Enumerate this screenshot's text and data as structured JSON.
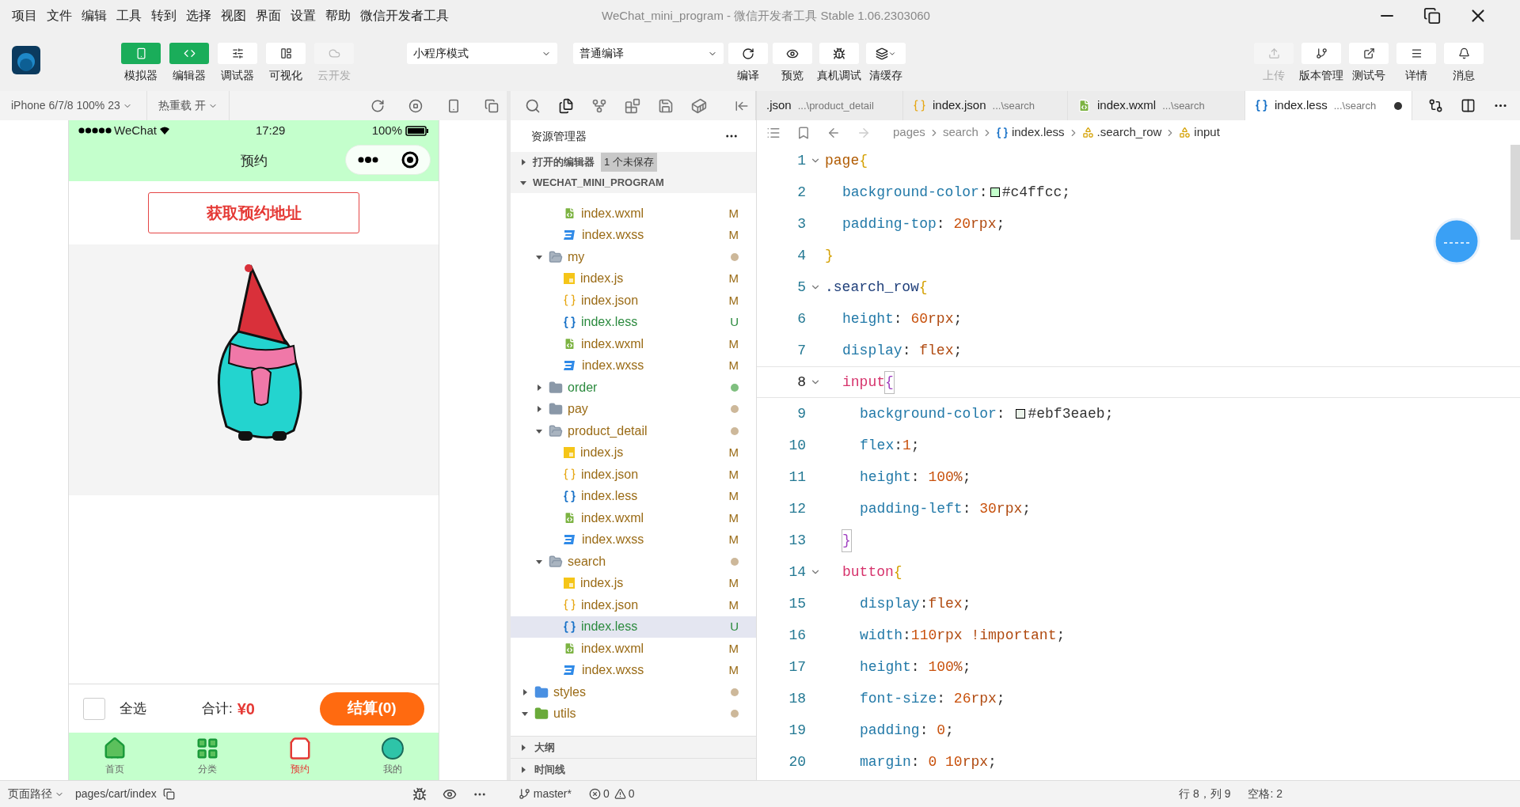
{
  "menu": [
    "项目",
    "文件",
    "编辑",
    "工具",
    "转到",
    "选择",
    "视图",
    "界面",
    "设置",
    "帮助",
    "微信开发者工具"
  ],
  "window": {
    "title": "WeChat_mini_program - 微信开发者工具 Stable 1.06.2303060"
  },
  "view_toggles": [
    {
      "label": "模拟器",
      "selected": true,
      "disabled": false
    },
    {
      "label": "编辑器",
      "selected": true,
      "disabled": false
    },
    {
      "label": "调试器",
      "selected": false,
      "disabled": false
    },
    {
      "label": "可视化",
      "selected": false,
      "disabled": false
    },
    {
      "label": "云开发",
      "selected": false,
      "disabled": true
    }
  ],
  "mode_select": {
    "value": "小程序模式"
  },
  "compile_select": {
    "value": "普通编译"
  },
  "actions": [
    {
      "label": "编译",
      "menu": false
    },
    {
      "label": "预览",
      "menu": false
    },
    {
      "label": "真机调试",
      "menu": false
    },
    {
      "label": "清缓存",
      "menu": true
    }
  ],
  "right_actions": [
    {
      "label": "上传",
      "disabled": true
    },
    {
      "label": "版本管理",
      "disabled": false
    },
    {
      "label": "测试号",
      "disabled": false
    },
    {
      "label": "详情",
      "disabled": false
    },
    {
      "label": "消息",
      "disabled": false
    }
  ],
  "simulator": {
    "device": "iPhone 6/7/8 100% 23",
    "hot_reload": "热重载 开",
    "phone": {
      "carrier": "WeChat",
      "time": "17:29",
      "battery": "100%",
      "title": "预约",
      "action_button": "获取预约地址",
      "select_all": {
        "label": "全选",
        "checked": false
      },
      "total_label": "合计:",
      "total": "¥0",
      "checkout": "结算(0)",
      "tabbar": [
        {
          "label": "首页",
          "selected": false
        },
        {
          "label": "分类",
          "selected": false
        },
        {
          "label": "预约",
          "selected": true
        },
        {
          "label": "我的",
          "selected": false
        }
      ]
    }
  },
  "explorer": {
    "title": "资源管理器",
    "open_editors": {
      "label": "打开的编辑器",
      "badge": "1 个未保存",
      "expanded": false
    },
    "project": {
      "label": "WECHAT_MINI_PROGRAM",
      "expanded": true
    },
    "tree": [
      {
        "kind": "continuation",
        "children": [
          {
            "kind": "continuation",
            "children": [
              {
                "kind": "wxml",
                "name": "index.wxml",
                "untracked": false,
                "badge": "M",
                "selected": false
              },
              {
                "kind": "wxss",
                "name": "index.wxss",
                "untracked": false,
                "badge": "M",
                "selected": false
              }
            ]
          },
          {
            "kind": "folder",
            "name": "my",
            "untracked": false,
            "expanded": true,
            "selected": false,
            "children": [
              {
                "kind": "js",
                "name": "index.js",
                "untracked": false,
                "badge": "M",
                "selected": false
              },
              {
                "kind": "json",
                "name": "index.json",
                "untracked": false,
                "badge": "M",
                "selected": false
              },
              {
                "kind": "less",
                "name": "index.less",
                "untracked": true,
                "badge": "U",
                "selected": false
              },
              {
                "kind": "wxml",
                "name": "index.wxml",
                "untracked": false,
                "badge": "M",
                "selected": false
              },
              {
                "kind": "wxss",
                "name": "index.wxss",
                "untracked": false,
                "badge": "M",
                "selected": false
              }
            ]
          },
          {
            "kind": "folder",
            "name": "order",
            "untracked": true,
            "expanded": false,
            "selected": false
          },
          {
            "kind": "folder",
            "name": "pay",
            "untracked": false,
            "expanded": false,
            "selected": false
          },
          {
            "kind": "folder",
            "name": "product_detail",
            "untracked": false,
            "expanded": true,
            "selected": false,
            "children": [
              {
                "kind": "js",
                "name": "index.js",
                "untracked": false,
                "badge": "M",
                "selected": false
              },
              {
                "kind": "json",
                "name": "index.json",
                "untracked": false,
                "badge": "M",
                "selected": false
              },
              {
                "kind": "less",
                "name": "index.less",
                "untracked": false,
                "badge": "M",
                "selected": false
              },
              {
                "kind": "wxml",
                "name": "index.wxml",
                "untracked": false,
                "badge": "M",
                "selected": false
              },
              {
                "kind": "wxss",
                "name": "index.wxss",
                "untracked": false,
                "badge": "M",
                "selected": false
              }
            ]
          },
          {
            "kind": "folder",
            "name": "search",
            "untracked": false,
            "expanded": true,
            "selected": false,
            "children": [
              {
                "kind": "js",
                "name": "index.js",
                "untracked": false,
                "badge": "M",
                "selected": false
              },
              {
                "kind": "json",
                "name": "index.json",
                "untracked": false,
                "badge": "M",
                "selected": false
              },
              {
                "kind": "less",
                "name": "index.less",
                "untracked": true,
                "badge": "U",
                "selected": true
              },
              {
                "kind": "wxml",
                "name": "index.wxml",
                "untracked": false,
                "badge": "M",
                "selected": false
              },
              {
                "kind": "wxss",
                "name": "index.wxss",
                "untracked": false,
                "badge": "M",
                "selected": false
              }
            ]
          }
        ]
      },
      {
        "kind": "styles-folder",
        "name": "styles",
        "untracked": false,
        "expanded": false,
        "selected": false
      },
      {
        "kind": "utils-folder",
        "name": "utils",
        "untracked": false,
        "expanded": true,
        "selected": false
      }
    ],
    "outline": {
      "label": "大纲",
      "expanded": false
    },
    "timeline": {
      "label": "时间线",
      "expanded": false
    }
  },
  "tabs": [
    {
      "name": ".json",
      "path": "...\\product_detail",
      "selected": false,
      "unsaved": false
    },
    {
      "name": "index.json",
      "path": "...\\search",
      "kind": "json",
      "selected": false,
      "unsaved": false
    },
    {
      "name": "index.wxml",
      "path": "...\\search",
      "kind": "wxml",
      "selected": false,
      "unsaved": false
    },
    {
      "name": "index.less",
      "path": "...\\search",
      "kind": "less",
      "selected": true,
      "unsaved": true
    }
  ],
  "breadcrumb": [
    {
      "kind": "folder",
      "text": "pages"
    },
    {
      "kind": "folder",
      "text": "search"
    },
    {
      "kind": "file",
      "text": "index.less"
    },
    {
      "kind": "symbol",
      "text": ".search_row"
    },
    {
      "kind": "symbol",
      "text": "input"
    }
  ],
  "code": [
    {
      "number": "1",
      "kind": "outer",
      "foldable": true,
      "current": false,
      "tokens": [
        {
          "kind": "selector",
          "text": "page"
        },
        {
          "kind": "brace",
          "text": "{"
        }
      ]
    },
    {
      "number": "2",
      "kind": "inner",
      "foldable": false,
      "current": false,
      "tokens": [
        {
          "kind": "property",
          "text": "background-color"
        },
        {
          "kind": "punct",
          "text": ":"
        },
        {
          "kind": "swatch",
          "color": "#c4ffcc"
        },
        {
          "kind": "punct",
          "text": "#c4ffcc;"
        }
      ]
    },
    {
      "number": "3",
      "kind": "inner",
      "foldable": false,
      "current": false,
      "tokens": [
        {
          "kind": "property",
          "text": "padding-top"
        },
        {
          "kind": "punct",
          "text": ": "
        },
        {
          "kind": "number",
          "text": "20"
        },
        {
          "kind": "value",
          "text": "rpx"
        },
        {
          "kind": "punct",
          "text": ";"
        }
      ]
    },
    {
      "number": "4",
      "kind": "outer",
      "foldable": false,
      "current": false,
      "tokens": [
        {
          "kind": "brace",
          "text": "}"
        }
      ]
    },
    {
      "number": "5",
      "kind": "outer",
      "foldable": true,
      "current": false,
      "tokens": [
        {
          "kind": "class",
          "text": ".search_row"
        },
        {
          "kind": "brace",
          "text": "{"
        }
      ]
    },
    {
      "number": "6",
      "kind": "inner",
      "foldable": false,
      "current": false,
      "tokens": [
        {
          "kind": "property",
          "text": "height"
        },
        {
          "kind": "punct",
          "text": ": "
        },
        {
          "kind": "number",
          "text": "60"
        },
        {
          "kind": "value",
          "text": "rpx"
        },
        {
          "kind": "punct",
          "text": ";"
        }
      ]
    },
    {
      "number": "7",
      "kind": "inner",
      "foldable": false,
      "current": false,
      "tokens": [
        {
          "kind": "property",
          "text": "display"
        },
        {
          "kind": "punct",
          "text": ": "
        },
        {
          "kind": "value",
          "text": "flex"
        },
        {
          "kind": "punct",
          "text": ";"
        }
      ]
    },
    {
      "number": "8",
      "kind": "inner",
      "foldable": true,
      "current": true,
      "tokens": [
        {
          "kind": "tag",
          "text": "input"
        },
        {
          "kind": "match",
          "text": "{"
        }
      ]
    },
    {
      "number": "9",
      "kind": "innermost",
      "foldable": false,
      "current": false,
      "tokens": [
        {
          "kind": "property",
          "text": "background-color"
        },
        {
          "kind": "punct",
          "text": ": "
        },
        {
          "kind": "swatch",
          "color": "#ebf3ea"
        },
        {
          "kind": "punct",
          "text": "#ebf3eaeb;"
        }
      ]
    },
    {
      "number": "10",
      "kind": "innermost",
      "foldable": false,
      "current": false,
      "tokens": [
        {
          "kind": "property",
          "text": "flex"
        },
        {
          "kind": "punct",
          "text": ":"
        },
        {
          "kind": "number",
          "text": "1"
        },
        {
          "kind": "punct",
          "text": ";"
        }
      ]
    },
    {
      "number": "11",
      "kind": "innermost",
      "foldable": false,
      "current": false,
      "tokens": [
        {
          "kind": "property",
          "text": "height"
        },
        {
          "kind": "punct",
          "text": ": "
        },
        {
          "kind": "number",
          "text": "100"
        },
        {
          "kind": "value",
          "text": "%"
        },
        {
          "kind": "punct",
          "text": ";"
        }
      ]
    },
    {
      "number": "12",
      "kind": "innermost",
      "foldable": false,
      "current": false,
      "tokens": [
        {
          "kind": "property",
          "text": "padding-left"
        },
        {
          "kind": "punct",
          "text": ": "
        },
        {
          "kind": "number",
          "text": "30"
        },
        {
          "kind": "value",
          "text": "rpx"
        },
        {
          "kind": "punct",
          "text": ";"
        }
      ]
    },
    {
      "number": "13",
      "kind": "inner",
      "foldable": false,
      "current": false,
      "tokens": [
        {
          "kind": "match",
          "text": "}"
        }
      ]
    },
    {
      "number": "14",
      "kind": "inner",
      "foldable": true,
      "current": false,
      "tokens": [
        {
          "kind": "tag",
          "text": "button"
        },
        {
          "kind": "brace",
          "text": "{"
        }
      ]
    },
    {
      "number": "15",
      "kind": "innermost",
      "foldable": false,
      "current": false,
      "tokens": [
        {
          "kind": "property",
          "text": "display"
        },
        {
          "kind": "punct",
          "text": ":"
        },
        {
          "kind": "value",
          "text": "flex"
        },
        {
          "kind": "punct",
          "text": ";"
        }
      ]
    },
    {
      "number": "16",
      "kind": "innermost",
      "foldable": false,
      "current": false,
      "tokens": [
        {
          "kind": "property",
          "text": "width"
        },
        {
          "kind": "punct",
          "text": ":"
        },
        {
          "kind": "number",
          "text": "110"
        },
        {
          "kind": "value",
          "text": "rpx !important"
        },
        {
          "kind": "punct",
          "text": ";"
        }
      ]
    },
    {
      "number": "17",
      "kind": "innermost",
      "foldable": false,
      "current": false,
      "tokens": [
        {
          "kind": "property",
          "text": "height"
        },
        {
          "kind": "punct",
          "text": ": "
        },
        {
          "kind": "number",
          "text": "100"
        },
        {
          "kind": "value",
          "text": "%"
        },
        {
          "kind": "punct",
          "text": ";"
        }
      ]
    },
    {
      "number": "18",
      "kind": "innermost",
      "foldable": false,
      "current": false,
      "tokens": [
        {
          "kind": "property",
          "text": "font-size"
        },
        {
          "kind": "punct",
          "text": ": "
        },
        {
          "kind": "number",
          "text": "26"
        },
        {
          "kind": "value",
          "text": "rpx"
        },
        {
          "kind": "punct",
          "text": ";"
        }
      ]
    },
    {
      "number": "19",
      "kind": "innermost",
      "foldable": false,
      "current": false,
      "tokens": [
        {
          "kind": "property",
          "text": "padding"
        },
        {
          "kind": "punct",
          "text": ": "
        },
        {
          "kind": "number",
          "text": "0"
        },
        {
          "kind": "punct",
          "text": ";"
        }
      ]
    },
    {
      "number": "20",
      "kind": "innermost",
      "foldable": false,
      "current": false,
      "tokens": [
        {
          "kind": "property",
          "text": "margin"
        },
        {
          "kind": "punct",
          "text": ": "
        },
        {
          "kind": "number",
          "text": "0 10"
        },
        {
          "kind": "value",
          "text": "rpx"
        },
        {
          "kind": "punct",
          "text": ";"
        }
      ]
    }
  ],
  "status_bar": {
    "page_path_label": "页面路径",
    "page_path": "pages/cart/index",
    "branch": "master*",
    "errors": "0",
    "warnings": "0",
    "cursor": "行 8，列 9",
    "indent": "空格: 2"
  }
}
